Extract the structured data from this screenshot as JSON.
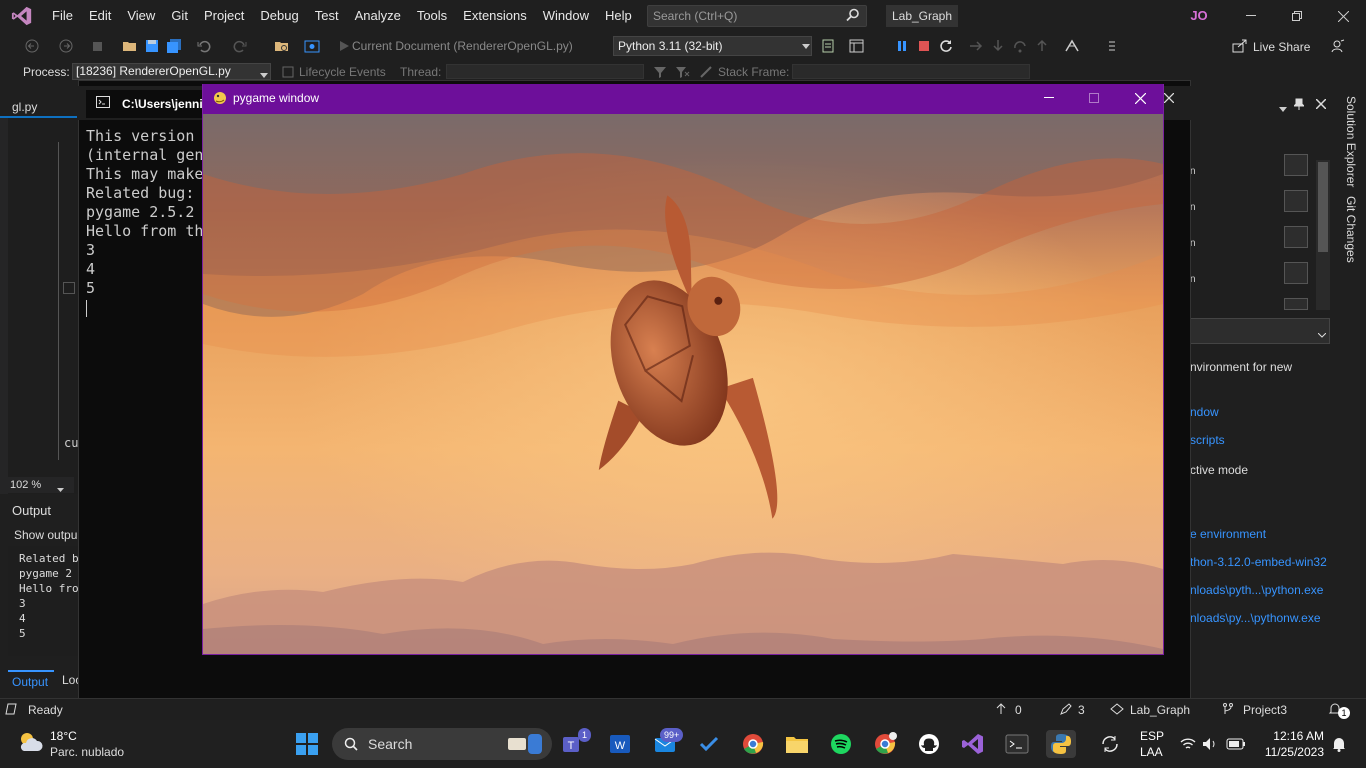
{
  "menubar": {
    "items": [
      "File",
      "Edit",
      "View",
      "Git",
      "Project",
      "Debug",
      "Test",
      "Analyze",
      "Tools",
      "Extensions",
      "Window",
      "Help"
    ],
    "search_placeholder": "Search (Ctrl+Q)",
    "solution_name": "Lab_Graph",
    "user_initials": "JO"
  },
  "toolbar": {
    "current_document": "Current Document (RendererOpenGL.py)",
    "python_env": "Python 3.11 (32-bit)",
    "live_share": "Live Share"
  },
  "debug_toolbar": {
    "process_label": "Process:",
    "process_value": "[18236] RendererOpenGL.py",
    "lifecycle_events": "Lifecycle Events",
    "thread_label": "Thread:",
    "stack_frame_label": "Stack Frame:"
  },
  "editor": {
    "tab_name": "gl.py",
    "snippet": "cu",
    "zoom_level": "102 %"
  },
  "output_panel": {
    "title": "Output",
    "show_output_from": "Show outpu",
    "lines": "Related b\npygame 2\nHello fro\n3\n4\n5",
    "tab_output": "Output",
    "tab_locals": "Loc"
  },
  "console": {
    "tab_title": "C:\\Users\\jenni",
    "text": "This version\n(internal gen\nThis may make\nRelated bug:\npygame 2.5.2\nHello from th\n3\n4\n5\n"
  },
  "pygame": {
    "title": "pygame window"
  },
  "right_panel": {
    "side_tabs": [
      "Solution Explorer",
      "Git Changes"
    ],
    "list_items": [
      "n",
      "n",
      "n",
      "n"
    ],
    "text_env_new": "nvironment for new",
    "link_window": "ndow",
    "link_scripts": "scripts",
    "text_interactive": "ctive mode",
    "link_environment": "e environment",
    "link_embed": "thon-3.12.0-embed-win32",
    "link_python_exe": "nloads\\pyth...\\python.exe",
    "link_pythonw_exe": "nloads\\py...\\pythonw.exe"
  },
  "status_bar": {
    "ready": "Ready",
    "errors": "0",
    "changes": "3",
    "branch": "Lab_Graph",
    "project": "Project3",
    "notifications": "1"
  },
  "taskbar": {
    "weather_temp": "18°C",
    "weather_desc": "Parc. nublado",
    "search_label": "Search",
    "teams_badge": "1",
    "mail_badge": "99+",
    "lang_1": "ESP",
    "lang_2": "LAA",
    "time": "12:16 AM",
    "date": "11/25/2023"
  },
  "colors": {
    "accent": "#0e70c0",
    "pygame_titlebar": "#6d0f9a",
    "link": "#3794ff",
    "sky_top": "#8a6a5a",
    "sky_bottom": "#f0b070",
    "turtle": "#c8643a"
  }
}
